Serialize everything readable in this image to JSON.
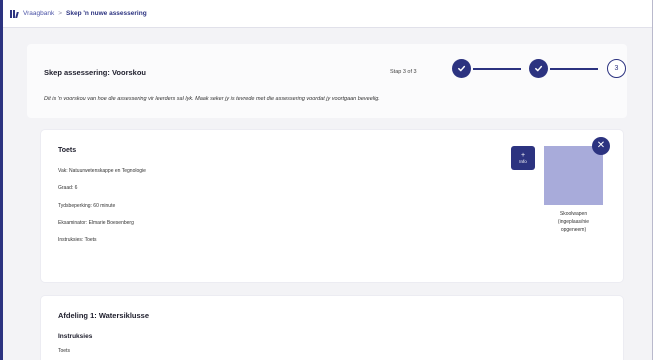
{
  "breadcrumb": {
    "root": "Vraagbank",
    "separator": ">",
    "current": "Skep 'n nuwe assessering"
  },
  "header": {
    "title": "Skep assessering: Voorskou",
    "step_text": "Stap 3 of 3",
    "description": "Dit is 'n voorskou van hoe die assessering vir leerders sal lyk. Maak seker jy is tevrede met die assessering voordat jy voortgaan beveelig.",
    "steps": [
      {
        "state": "done",
        "label": "✓"
      },
      {
        "state": "done",
        "label": "✓"
      },
      {
        "state": "current",
        "label": "3"
      }
    ]
  },
  "info": {
    "title": "Toets",
    "lines": [
      "Vak: Natuurwetenskappe en Tegnologie",
      "Graad: 6",
      "Tydsbeperking: 60 minute",
      "Eksaminator: Elmarie Boesenberg",
      "Instruksies: Toets"
    ],
    "info_button": {
      "plus": "+",
      "label": "Info"
    },
    "close_label": "✕",
    "image_caption": "Skoolwapen\n(ingeplaas/nie\nopgeneem)"
  },
  "section": {
    "title": "Afdeling 1: Watersiklusse",
    "subtitle": "Instruksies",
    "text": "Toets"
  },
  "colors": {
    "primary": "#2c3380",
    "image_placeholder": "#a8abda"
  }
}
